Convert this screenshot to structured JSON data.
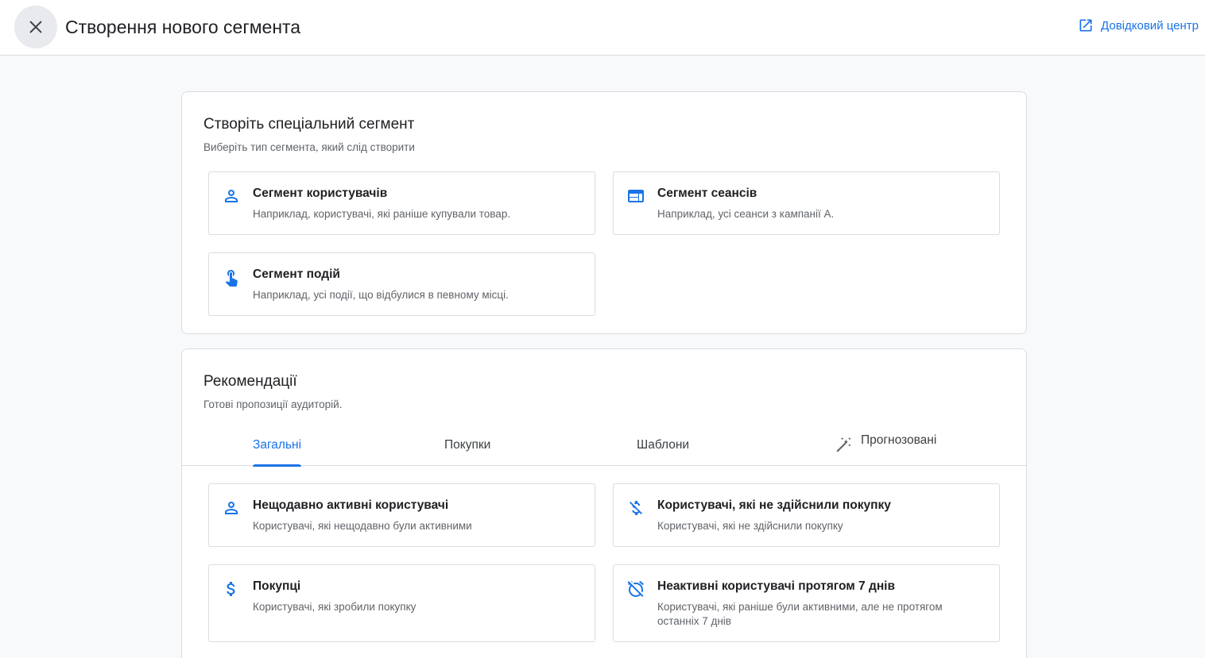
{
  "header": {
    "title": "Створення нового сегмента",
    "help_label": "Довідковий центр"
  },
  "custom": {
    "title": "Створіть спеціальний сегмент",
    "subtitle": "Виберіть тип сегмента, який слід створити",
    "options": [
      {
        "title": "Сегмент користувачів",
        "desc": "Наприклад, користувачі, які раніше купували товар.",
        "icon": "person-icon"
      },
      {
        "title": "Сегмент сеансів",
        "desc": "Наприклад, усі сеанси з кампанії A.",
        "icon": "web-window-icon"
      },
      {
        "title": "Сегмент подій",
        "desc": "Наприклад, усі події, що відбулися в певному місці.",
        "icon": "touch-hand-icon"
      }
    ]
  },
  "recommendations": {
    "title": "Рекомендації",
    "subtitle": "Готові пропозиції аудиторій.",
    "tabs": [
      {
        "label": "Загальні",
        "active": true
      },
      {
        "label": "Покупки",
        "active": false
      },
      {
        "label": "Шаблони",
        "active": false
      },
      {
        "label": "Прогнозовані",
        "active": false,
        "icon": "magic-wand-icon"
      }
    ],
    "items": [
      {
        "title": "Нещодавно активні користувачі",
        "desc": "Користувачі, які нещодавно були активними",
        "icon": "person-icon"
      },
      {
        "title": "Користувачі, які не здійснили покупку",
        "desc": "Користувачі, які не здійснили покупку",
        "icon": "money-off-icon"
      },
      {
        "title": "Покупці",
        "desc": "Користувачі, які зробили покупку",
        "icon": "dollar-icon"
      },
      {
        "title": "Неактивні користувачі протягом 7 днів",
        "desc": "Користувачі, які раніше були активними, але не протягом останніх 7 днів",
        "icon": "alarm-off-icon"
      }
    ]
  },
  "colors": {
    "accent": "#1a73e8",
    "text": "#202124",
    "secondary_text": "#5f6368",
    "border": "#dadce0"
  }
}
